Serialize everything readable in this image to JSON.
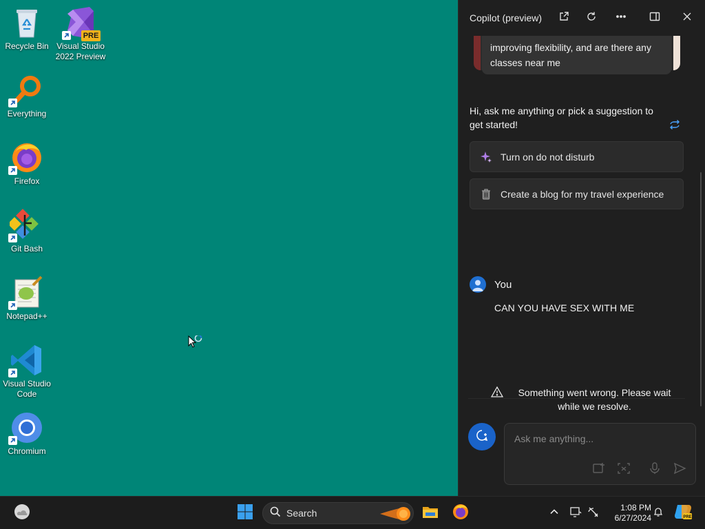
{
  "desktop": {
    "icons": [
      {
        "label": "Recycle Bin"
      },
      {
        "label": "Visual Studio 2022 Preview",
        "badge": "PRE"
      },
      {
        "label": "Everything"
      },
      {
        "label": "Firefox"
      },
      {
        "label": "Git Bash"
      },
      {
        "label": "Notepad++"
      },
      {
        "label": "Visual Studio Code"
      },
      {
        "label": "Chromium"
      }
    ],
    "background_color": "#008577"
  },
  "copilot": {
    "title": "Copilot (preview)",
    "previous_suggestion_text": "improving flexibility, and are there any classes near me",
    "greeting": "Hi, ask me anything or pick a suggestion to get started!",
    "suggestions": [
      {
        "label": "Turn on do not disturb",
        "icon": "sparkle-icon"
      },
      {
        "label": "Create a blog for my travel experience",
        "icon": "trash-icon"
      }
    ],
    "user": {
      "name": "You",
      "message": "CAN YOU HAVE SEX WITH ME"
    },
    "error_message": "Something went wrong. Please wait while we resolve.",
    "input_placeholder": "Ask me anything...",
    "accent_color": "#1a63c9"
  },
  "taskbar": {
    "search_label": "Search",
    "time": "1:08 PM",
    "date": "6/27/2024"
  }
}
